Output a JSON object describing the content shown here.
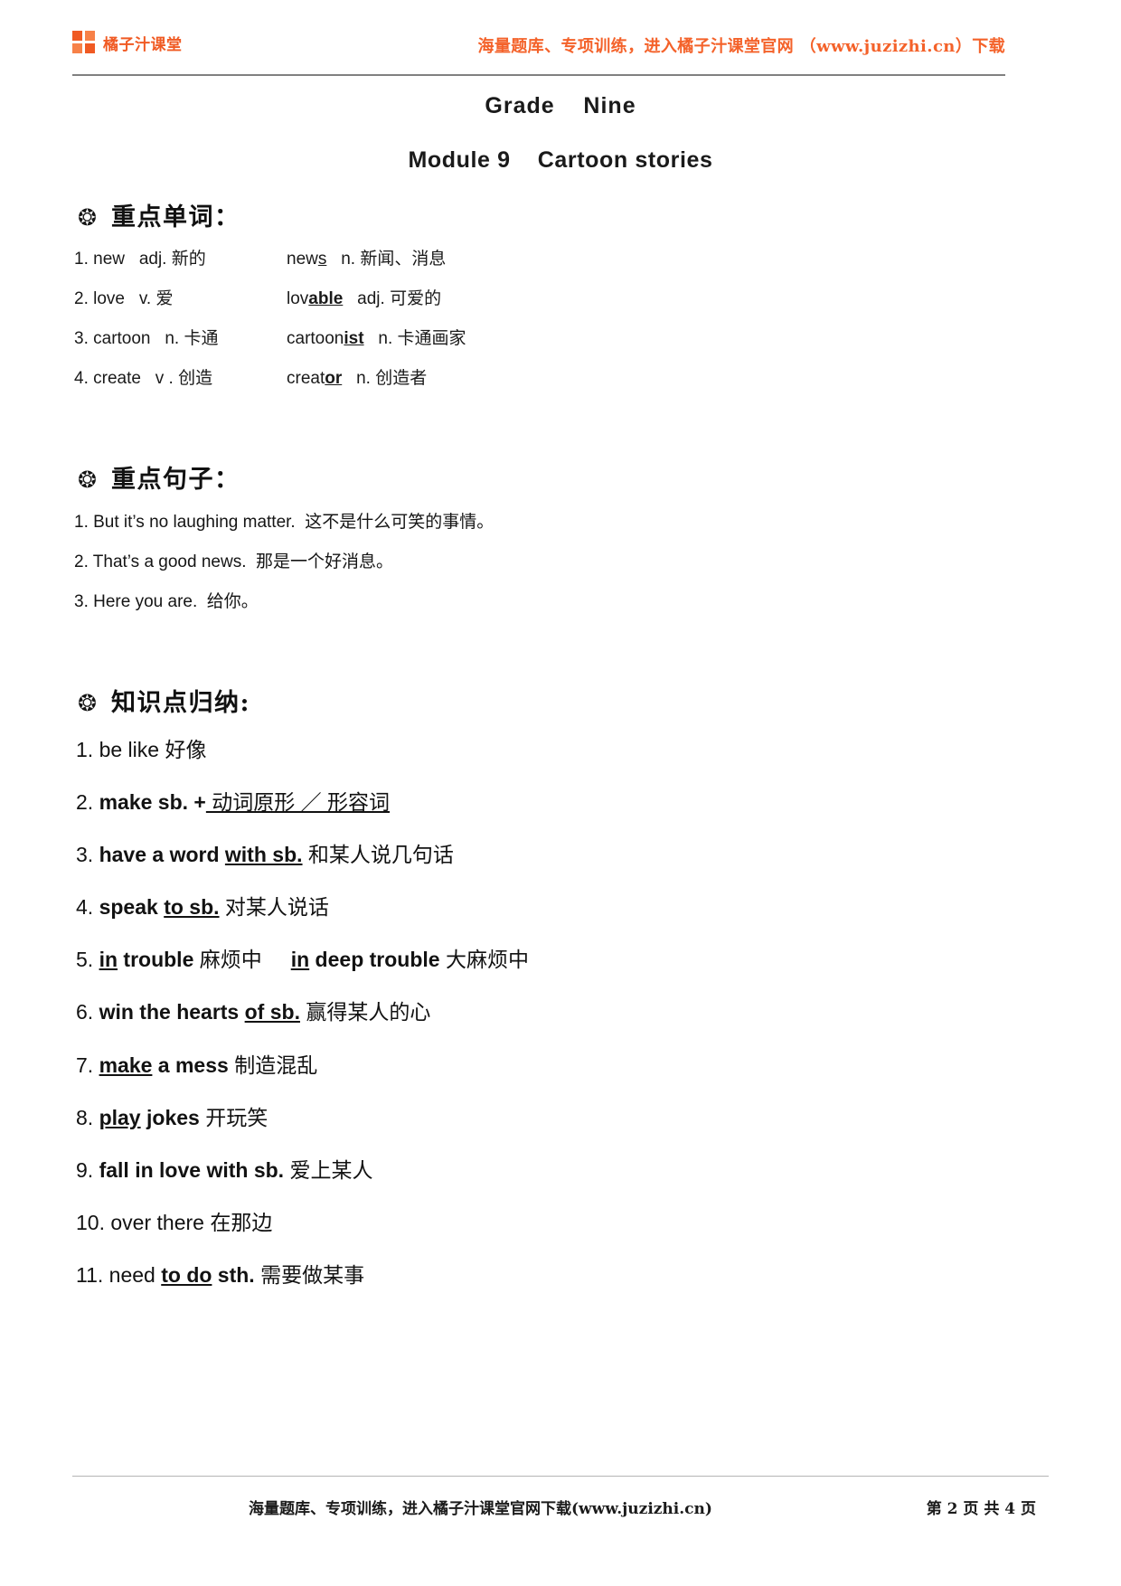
{
  "header": {
    "brand_name": "橘子汁课堂",
    "brand_icon": "squares-logo-icon",
    "tagline": "海量题库、专项训练，进入橘子汁课堂官网 （www.juzizhi.cn）下载",
    "accent_color": "#f05a23",
    "tagline_color": "#f4622a"
  },
  "titles": {
    "grade": "Grade    Nine",
    "module": "Module 9    Cartoon stories"
  },
  "sections": {
    "words": {
      "icon": "diamond-bullet-icon",
      "title": "重点单词："
    },
    "sentences": {
      "icon": "diamond-bullet-icon",
      "title": "重点句子："
    },
    "knowledge": {
      "icon": "diamond-bullet-icon",
      "title": "知识点归纳:"
    }
  },
  "words": [
    {
      "num": "1.",
      "base": "new",
      "base_pos": "adj.",
      "base_cn": "新的",
      "derived_stem": "new",
      "derived_suffix": "s",
      "derived_pos": "n.",
      "derived_cn": "新闻、消息"
    },
    {
      "num": "2.",
      "base": "love",
      "base_pos": "v.",
      "base_cn": "爱",
      "derived_stem": "lov",
      "derived_suffix": "able",
      "derived_pos": "adj.",
      "derived_cn": "可爱的"
    },
    {
      "num": "3.",
      "base": "cartoon",
      "base_pos": "n.",
      "base_cn": "卡通",
      "derived_stem": "cartoon",
      "derived_suffix": "ist",
      "derived_pos": "n.",
      "derived_cn": "卡通画家"
    },
    {
      "num": "4.",
      "base": "create",
      "base_pos": "v .",
      "base_cn": "创造",
      "derived_stem": "creat",
      "derived_suffix": "or",
      "derived_pos": "n.",
      "derived_cn": "创造者"
    }
  ],
  "sentences": [
    {
      "num": "1.",
      "en": "But it’s no laughing matter.",
      "cn": "这不是什么可笑的事情。"
    },
    {
      "num": "2.",
      "en": "That’s a good news.",
      "cn": "那是一个好消息。"
    },
    {
      "num": "3.",
      "en": "Here you are.",
      "cn": "给你。"
    }
  ],
  "knowledge_points": [
    {
      "num": "1.",
      "a": "be like",
      "b": "",
      "c": "",
      "cn": "好像"
    },
    {
      "num": "2.",
      "a": "make sb. +",
      "b": "",
      "c": "",
      "cn": "动词原形 ／ 形容词",
      "cn_underline": true,
      "a_bold": true
    },
    {
      "num": "3.",
      "a": "have a word ",
      "b": "with sb.",
      "c": "",
      "cn": "和某人说几句话",
      "a_bold": true
    },
    {
      "num": "4.",
      "a": "speak ",
      "b": "to sb.",
      "c": "",
      "cn": "对某人说话",
      "a_bold": true
    },
    {
      "num": "5.",
      "a": "",
      "b": "in",
      "c": " trouble",
      "cn": "麻烦中",
      "extra_b": "in",
      "extra_c": " deep trouble",
      "extra_cn": "大麻烦中"
    },
    {
      "num": "6.",
      "a": "win the hearts ",
      "b": "of sb.",
      "c": "",
      "cn": "赢得某人的心",
      "a_bold": true
    },
    {
      "num": "7.",
      "a": "",
      "b": "make",
      "c": " a mess",
      "cn": "制造混乱"
    },
    {
      "num": "8.",
      "a": "",
      "b": "play",
      "c": " jokes",
      "cn": "开玩笑"
    },
    {
      "num": "9.",
      "a": "fall in love with sb.",
      "b": "",
      "c": "",
      "cn": "爱上某人",
      "a_bold": true
    },
    {
      "num": "10.",
      "a": "over there",
      "b": "",
      "c": "",
      "cn": "在那边"
    },
    {
      "num": "11.",
      "a": "need ",
      "b": "to do",
      "c": " sth.",
      "cn": "需要做某事"
    }
  ],
  "footer": {
    "note": "海量题库、专项训练，进入橘子汁课堂官网下载(www.juzizhi.cn)",
    "page_label": "第 2 页 共 4 页"
  }
}
